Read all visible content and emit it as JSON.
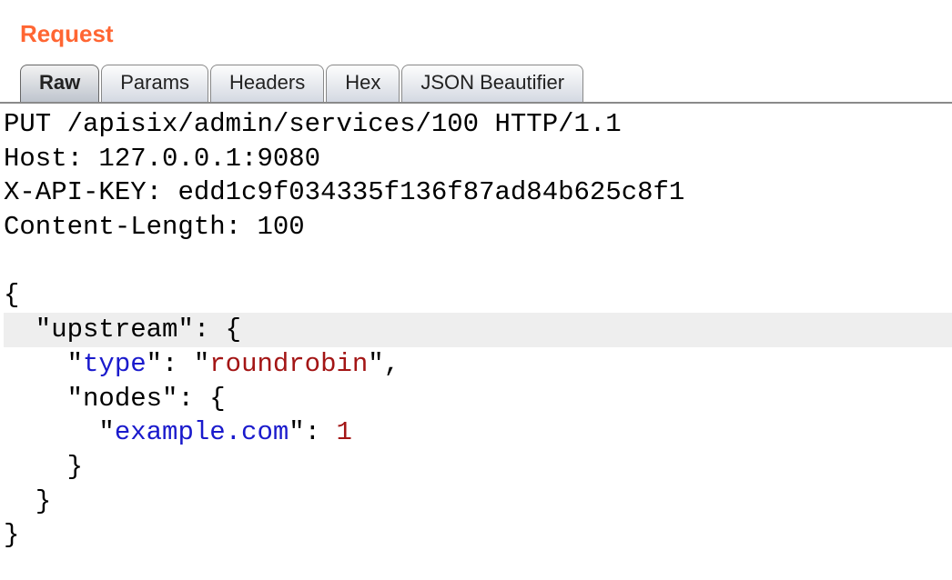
{
  "header": {
    "title": "Request"
  },
  "tabs": {
    "items": [
      {
        "label": "Raw",
        "name": "tab-raw"
      },
      {
        "label": "Params",
        "name": "tab-params"
      },
      {
        "label": "Headers",
        "name": "tab-headers"
      },
      {
        "label": "Hex",
        "name": "tab-hex"
      },
      {
        "label": "JSON Beautifier",
        "name": "tab-json-beautifier"
      }
    ],
    "active": "Raw"
  },
  "request": {
    "start_line": "PUT /apisix/admin/services/100 HTTP/1.1",
    "headers": {
      "host_label": "Host: ",
      "host_value": "127.0.0.1:9080",
      "api_key_label": "X-API-KEY: ",
      "api_key_value": "edd1c9f034335f136f87ad84b625c8f1",
      "content_length_label": "Content-Length: ",
      "content_length_value": "100"
    },
    "body": {
      "brace_open": "{",
      "upstream_key": "upstream",
      "upstream_open": ": {",
      "type_key": "type",
      "type_sep": ": ",
      "type_value": "roundrobin",
      "type_comma": ",",
      "nodes_key": "nodes",
      "nodes_open": ": {",
      "example_key": "example.com",
      "example_sep": ": ",
      "example_value": "1",
      "nodes_close": "}",
      "upstream_close": "}",
      "brace_close": "}"
    }
  }
}
